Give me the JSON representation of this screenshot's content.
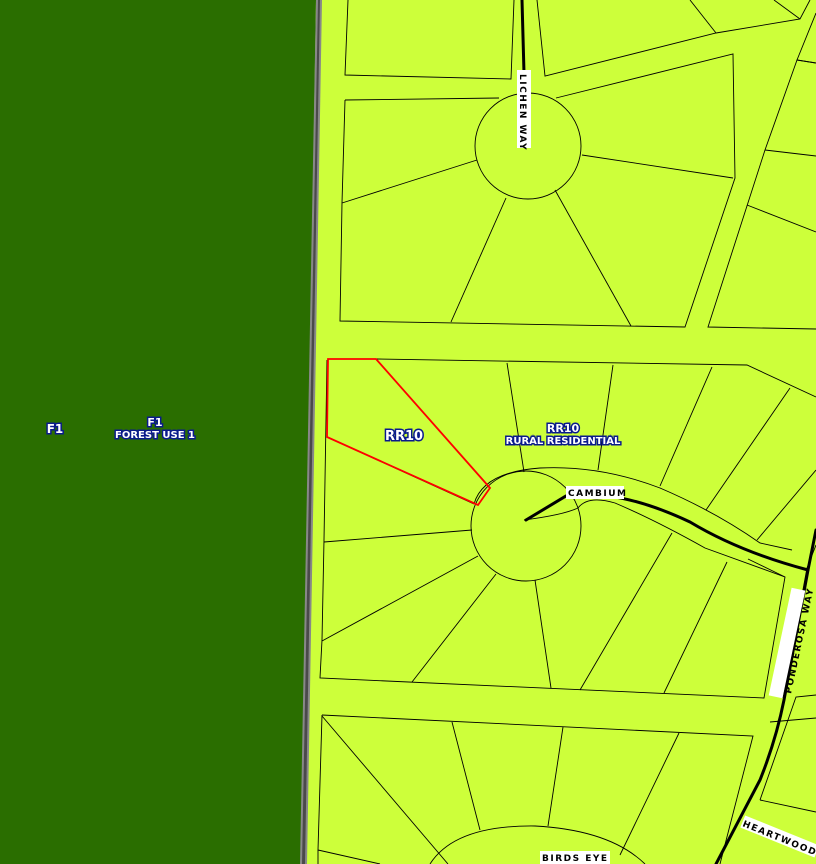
{
  "map": {
    "colors": {
      "forest": "#2a6e00",
      "residential": "#cdff3a",
      "parcel_line": "#000000",
      "highlight": "#ff0000",
      "zone_label_fill": "#ffffff",
      "zone_label_outline": "#0a1a8c",
      "boundary_road": "#888888"
    },
    "zones": {
      "forest_code": "F1",
      "forest_code_2": "F1",
      "forest_name": "FOREST USE 1",
      "residential_code": "RR10",
      "residential_code_2": "RR10",
      "residential_name": "RURAL RESIDENTIAL"
    },
    "roads": {
      "lichen": "LICHEN WAY",
      "cambium": "CAMBIUM",
      "ponderosa": "PONDEROSA WAY",
      "heartwood": "HEARTWOOD",
      "birds_eye": "BIRDS EYE"
    }
  }
}
